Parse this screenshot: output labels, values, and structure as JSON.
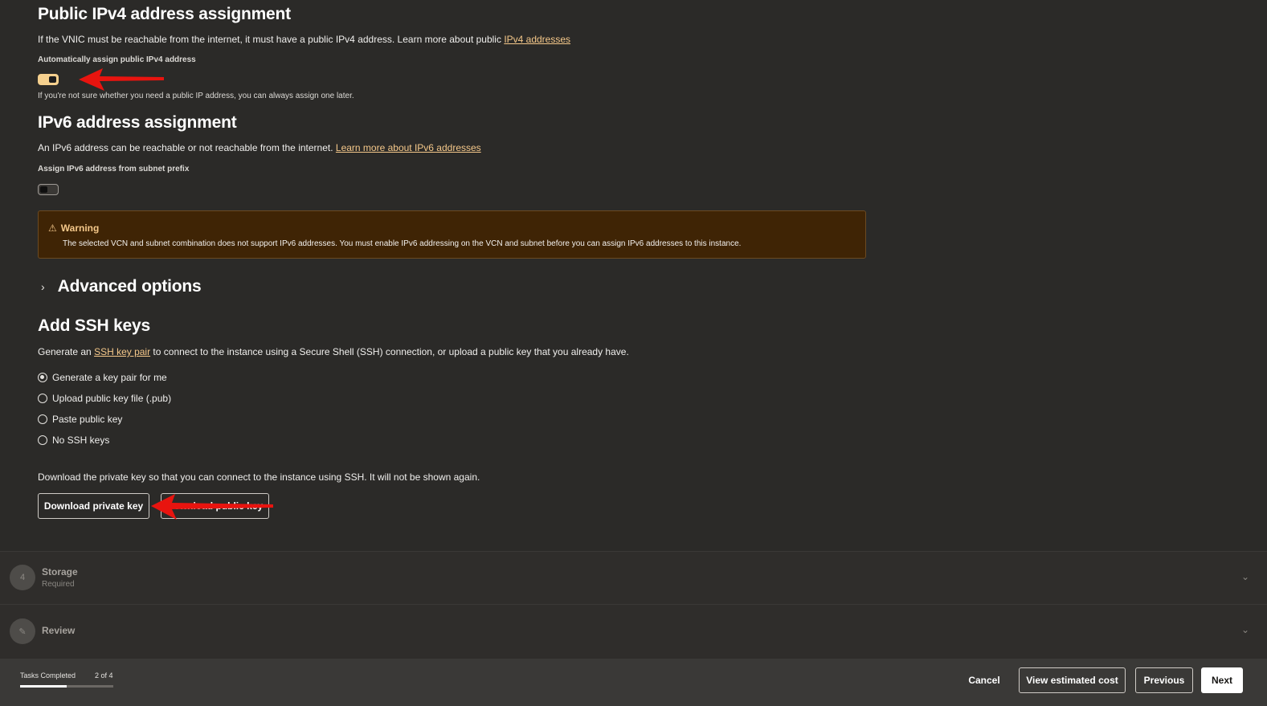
{
  "ipv4": {
    "heading": "Public IPv4 address assignment",
    "desc_text": "If the VNIC must be reachable from the internet, it must have a public IPv4 address. Learn more about public ",
    "desc_link": "IPv4 addresses",
    "toggle_label": "Automatically assign public IPv4 address",
    "toggle_on": true,
    "hint": "If you're not sure whether you need a public IP address, you can always assign one later."
  },
  "ipv6": {
    "heading": "IPv6 address assignment",
    "desc_text": "An IPv6 address can be reachable or not reachable from the internet. ",
    "desc_link": "Learn more about IPv6 addresses",
    "toggle_label": "Assign IPv6 address from subnet prefix",
    "toggle_on": false
  },
  "warning": {
    "title": "Warning",
    "text": "The selected VCN and subnet combination does not support IPv6 addresses. You must enable IPv6 addressing on the VCN and subnet before you can assign IPv6 addresses to this instance."
  },
  "advanced": {
    "label": "Advanced options"
  },
  "ssh": {
    "heading": "Add SSH keys",
    "desc_before": "Generate an ",
    "desc_link": "SSH key pair",
    "desc_after": " to connect to the instance using a Secure Shell (SSH) connection, or upload a public key that you already have.",
    "options": [
      {
        "label": "Generate a key pair for me",
        "checked": true
      },
      {
        "label": "Upload public key file (.pub)",
        "checked": false
      },
      {
        "label": "Paste public key",
        "checked": false
      },
      {
        "label": "No SSH keys",
        "checked": false
      }
    ],
    "download_note": "Download the private key so that you can connect to the instance using SSH. It will not be shown again.",
    "download_private": "Download private key",
    "download_public": "Download public key"
  },
  "steps": [
    {
      "number": "4",
      "title": "Storage",
      "subtitle": "Required"
    },
    {
      "number": "✎",
      "title": "Review",
      "subtitle": ""
    }
  ],
  "footer": {
    "tasks_label": "Tasks Completed",
    "tasks_count": "2 of 4",
    "progress": 0.5,
    "cancel": "Cancel",
    "view_cost": "View estimated cost",
    "previous": "Previous",
    "next": "Next"
  },
  "colors": {
    "background": "#2b2a28",
    "accent_link": "#f5c88a",
    "toggle_on": "#f5d08e",
    "warning_bg": "#3f2405",
    "annotation_arrow": "#e8140f"
  }
}
